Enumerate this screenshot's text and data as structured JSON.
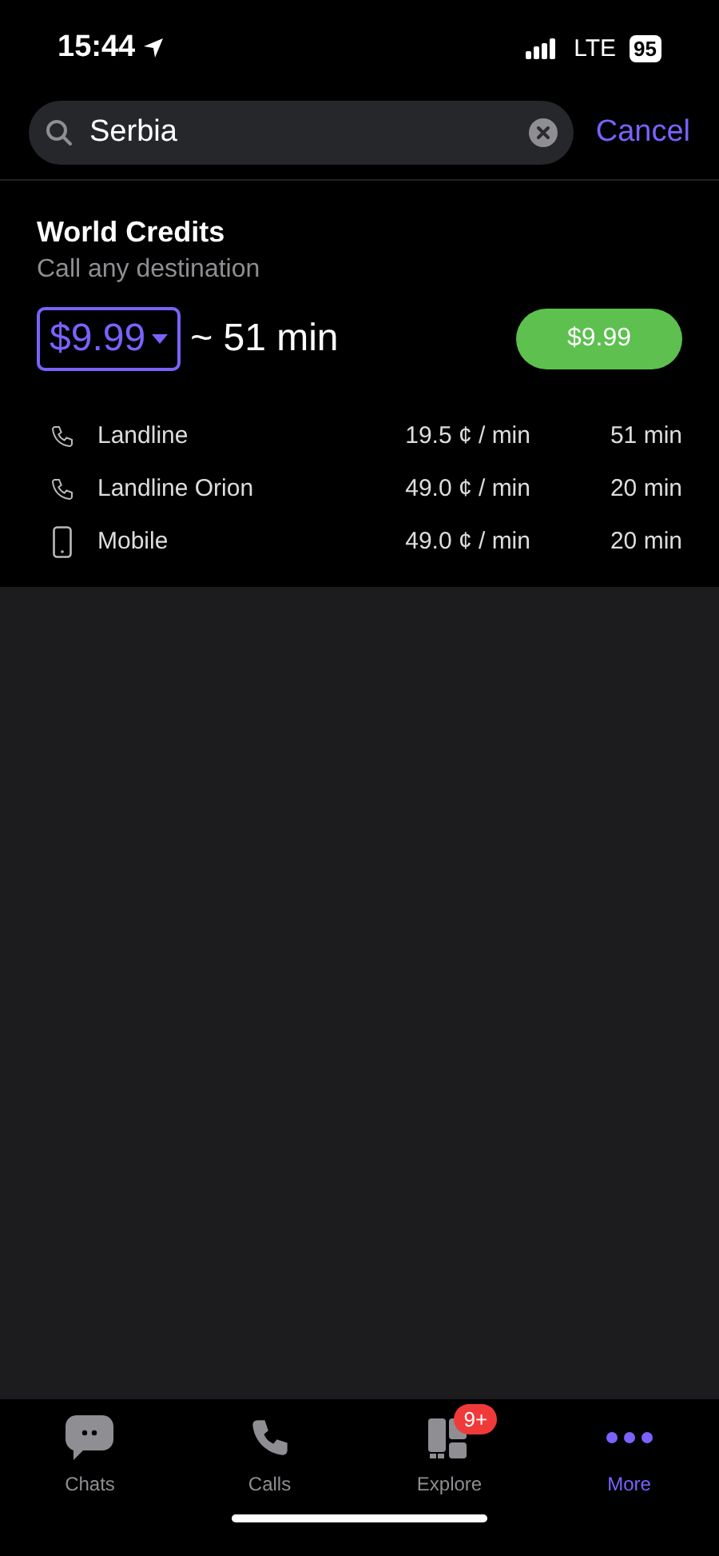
{
  "status_bar": {
    "time": "15:44",
    "network": "LTE",
    "battery": "95"
  },
  "search": {
    "value": "Serbia",
    "cancel": "Cancel"
  },
  "plan": {
    "title": "World Credits",
    "subtitle": "Call any destination",
    "amount": "$9.99",
    "minutes": "~ 51 min",
    "buy": "$9.99",
    "rates": [
      {
        "kind": "landline",
        "name": "Landline",
        "price": "19.5 ¢ / min",
        "minutes": "51 min"
      },
      {
        "kind": "landline",
        "name": "Landline Orion",
        "price": "49.0 ¢ / min",
        "minutes": "20 min"
      },
      {
        "kind": "mobile",
        "name": "Mobile",
        "price": "49.0 ¢ / min",
        "minutes": "20 min"
      }
    ]
  },
  "tabs": [
    {
      "kind": "chats",
      "label": "Chats",
      "selected": false
    },
    {
      "kind": "calls",
      "label": "Calls",
      "selected": false
    },
    {
      "kind": "explore",
      "label": "Explore",
      "selected": false,
      "badge": "9+"
    },
    {
      "kind": "more",
      "label": "More",
      "selected": true
    }
  ]
}
